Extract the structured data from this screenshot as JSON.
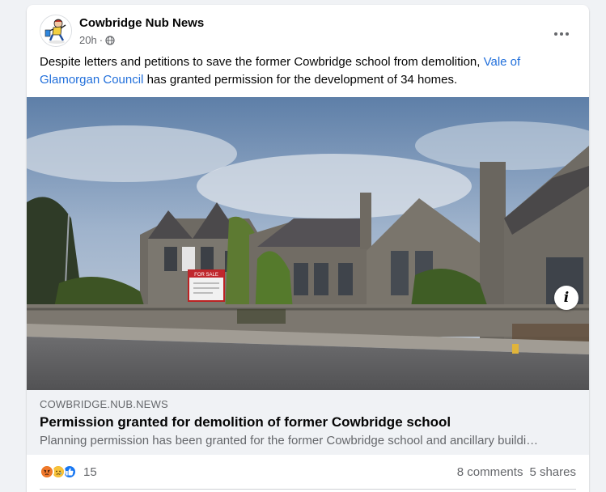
{
  "post": {
    "page_name": "Cowbridge Nub News",
    "time": "20h",
    "separator": "·",
    "audience_icon": "globe-icon",
    "text_before": "Despite letters and petitions to save the former Cowbridge school from demolition, ",
    "text_link": "Vale of Glamorgan Council",
    "text_after": " has granted permission for the development of 34 homes.",
    "more_label": "•••"
  },
  "image": {
    "sign_text": "FOR SALE",
    "info_label": "i"
  },
  "link_preview": {
    "domain": "COWBRIDGE.NUB.NEWS",
    "title": "Permission granted for demolition of former Cowbridge school",
    "description": "Planning permission has been granted for the former Cowbridge school and ancillary buildi…"
  },
  "engagement": {
    "reaction_icons": [
      "angry-reaction-icon",
      "sad-reaction-icon",
      "like-reaction-icon"
    ],
    "reaction_count": "15",
    "comments": "8 comments",
    "shares": "5 shares"
  },
  "colors": {
    "link_blue": "#216fdb",
    "like_blue": "#1877f2",
    "angry_orange": "#e9710f",
    "sad_yellow": "#f7b125"
  }
}
